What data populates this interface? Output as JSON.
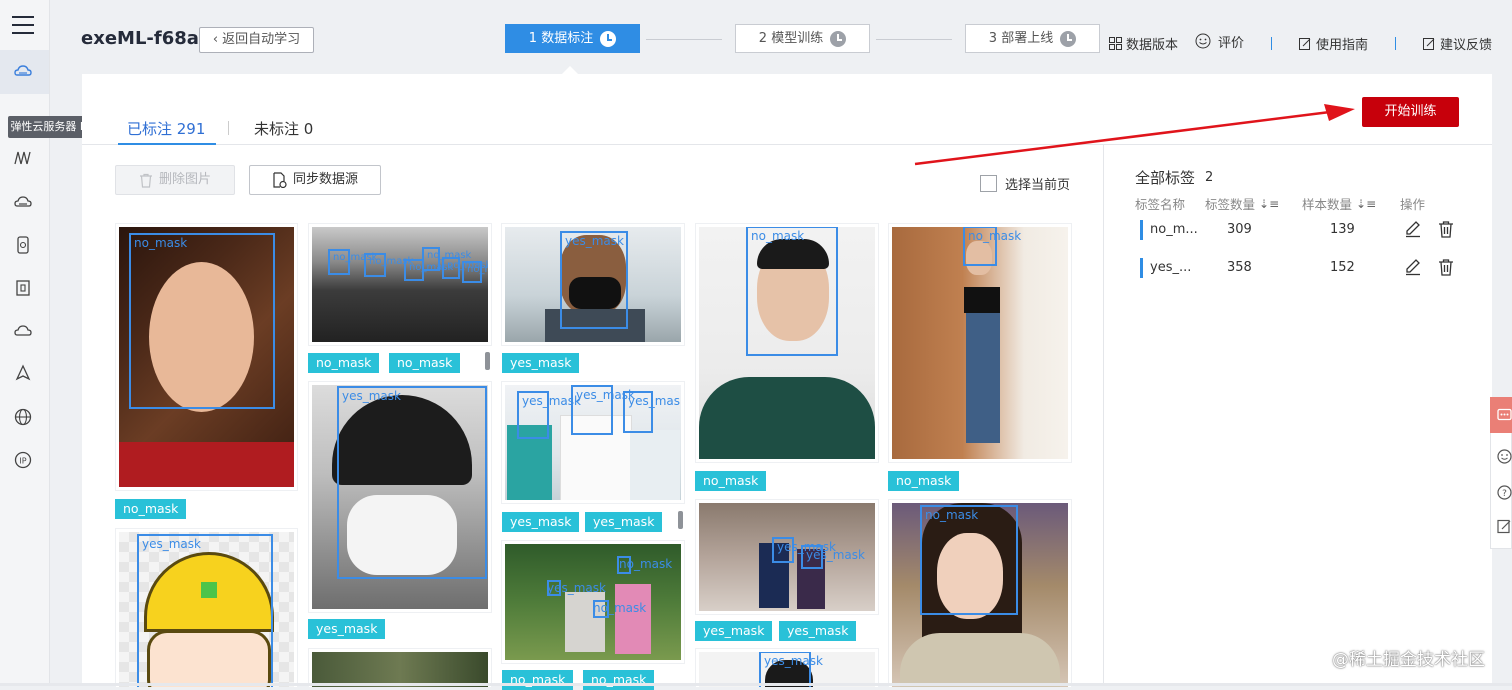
{
  "header": {
    "app_title": "exeML-f68a",
    "back_label": "返回自动学习",
    "steps": [
      {
        "label": "1 数据标注",
        "active": true
      },
      {
        "label": "2 模型训练",
        "active": false
      },
      {
        "label": "3 部署上线",
        "active": false
      }
    ],
    "links": {
      "data_version": "数据版本",
      "rate": "评价",
      "guide": "使用指南",
      "feedback": "建议反馈"
    }
  },
  "sidebar": {
    "tooltip": "弹性云服务器 ECS",
    "icons": [
      "menu-icon",
      "cloud-server-icon",
      "user-icon",
      "modelarts-icon",
      "cloud-disk-icon",
      "storage-icon",
      "database-icon",
      "cloud-icon",
      "deploy-icon",
      "globe-icon",
      "ip-icon"
    ]
  },
  "tabs": [
    {
      "label": "已标注 291",
      "active": true
    },
    {
      "label": "未标注 0",
      "active": false
    }
  ],
  "toolbar": {
    "delete_label": "删除图片",
    "sync_label": "同步数据源",
    "select_page_label": "选择当前页",
    "start_train_label": "开始训练"
  },
  "colors": {
    "primary": "#2f8de4",
    "danger": "#c7000b",
    "tag": "#29c1d8",
    "box": "#3b8ce6"
  },
  "gallery": {
    "cards": [
      {
        "boxes": [
          "no_mask"
        ],
        "tags": [
          "no_mask"
        ]
      },
      {
        "boxes": [
          "yes_mask"
        ],
        "tags": []
      },
      {
        "boxes": [
          "no_mask",
          "no_mask",
          "no_mask",
          "no_mask",
          "no_mask",
          "no_mask"
        ],
        "tags": [
          "no_mask",
          "no_mask"
        ]
      },
      {
        "boxes": [
          "yes_mask"
        ],
        "tags": [
          "yes_mask"
        ]
      },
      {
        "boxes": [],
        "tags": []
      },
      {
        "boxes": [
          "yes_mask"
        ],
        "tags": [
          "yes_mask"
        ]
      },
      {
        "boxes": [
          "yes_mask",
          "yes_mask",
          "yes_mask"
        ],
        "tags": [
          "yes_mask",
          "yes_mask"
        ]
      },
      {
        "boxes": [
          "yes_mask",
          "no_mask",
          "no_mask"
        ],
        "tags": [
          "no_mask",
          "no_mask"
        ]
      },
      {
        "boxes": [
          "no_mask"
        ],
        "tags": [
          "no_mask"
        ]
      },
      {
        "boxes": [
          "yes_mask",
          "yes_mask"
        ],
        "tags": [
          "yes_mask",
          "yes_mask"
        ]
      },
      {
        "boxes": [
          "yes_mask"
        ],
        "tags": []
      },
      {
        "boxes": [
          "no_mask"
        ],
        "tags": [
          "no_mask"
        ]
      },
      {
        "boxes": [
          "no_mask"
        ],
        "tags": []
      }
    ]
  },
  "labels_panel": {
    "title": "全部标签",
    "count": "2",
    "headers": {
      "name": "标签名称",
      "tag_count": "标签数量",
      "sample_count": "样本数量",
      "action": "操作"
    },
    "rows": [
      {
        "name": "no_m...",
        "tag_count": "309",
        "sample_count": "139"
      },
      {
        "name": "yes_...",
        "tag_count": "358",
        "sample_count": "152"
      }
    ]
  },
  "watermark": "@稀土掘金技术社区"
}
